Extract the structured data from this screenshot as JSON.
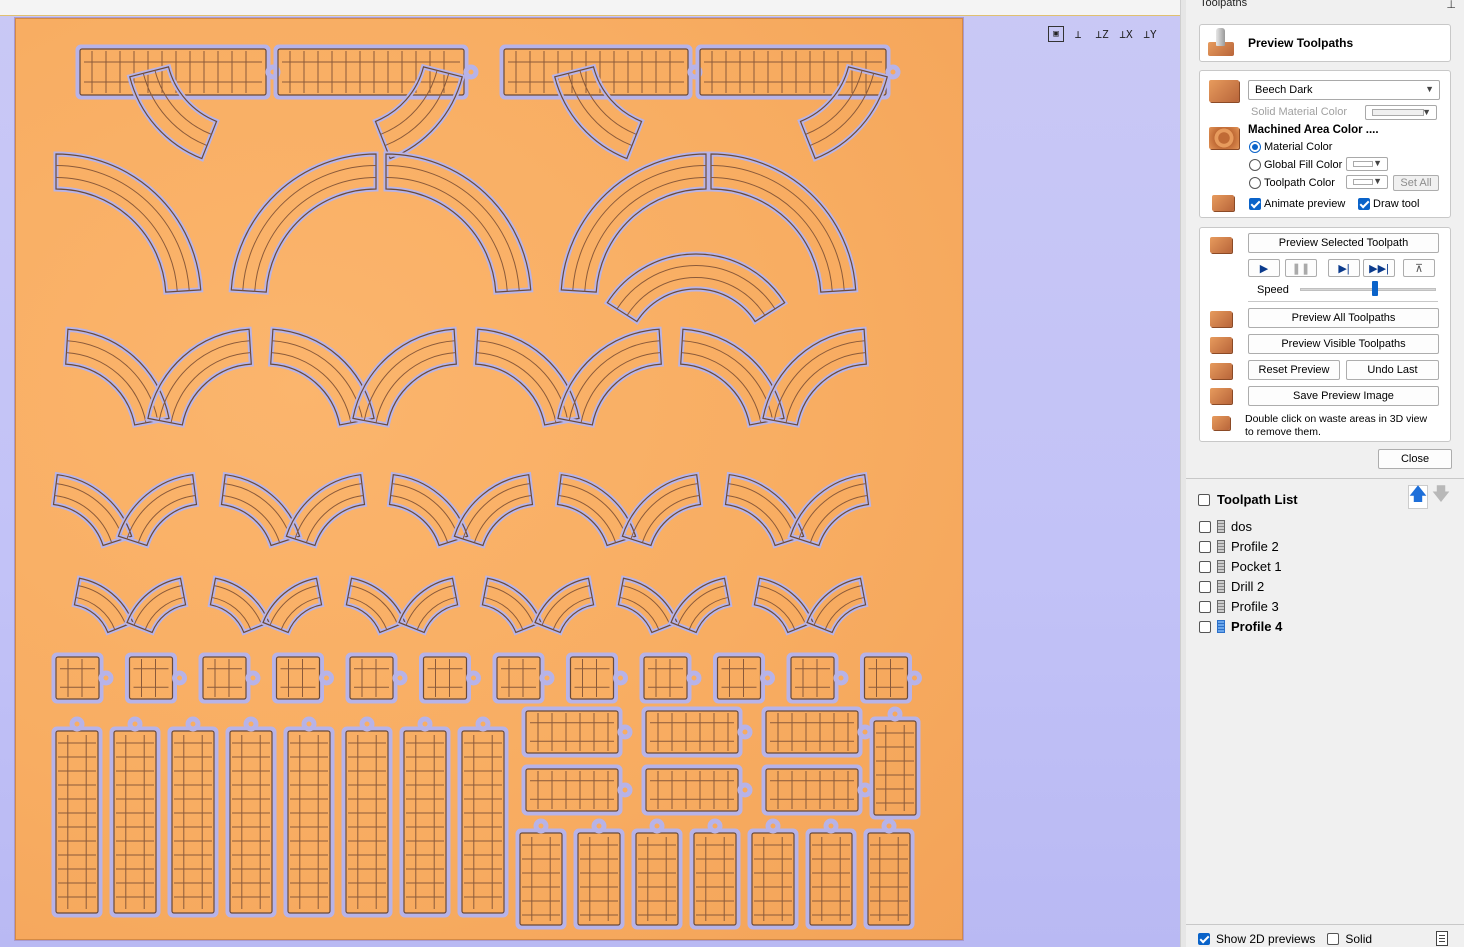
{
  "panel": {
    "title": "Toolpaths",
    "header_title": "Preview Toolpaths"
  },
  "material": {
    "selected": "Beech Dark",
    "solid_color_label": "Solid Material Color",
    "machined_label": "Machined Area Color ....",
    "options": {
      "material_color": "Material Color",
      "global_fill": "Global Fill Color",
      "toolpath_color": "Toolpath Color"
    },
    "selected_option": "material_color",
    "set_all": "Set All",
    "animate_preview": "Animate preview",
    "draw_tool": "Draw tool"
  },
  "preview": {
    "selected_btn": "Preview Selected Toolpath",
    "speed_label": "Speed",
    "speed_level": 0.55,
    "all_btn": "Preview All Toolpaths",
    "visible_btn": "Preview Visible Toolpaths",
    "reset_btn": "Reset Preview",
    "undo_btn": "Undo Last",
    "save_btn": "Save Preview Image",
    "hint_line1": "Double click on waste areas in 3D view",
    "hint_line2": "to remove them."
  },
  "close_btn": "Close",
  "toolpath_list": {
    "title": "Toolpath List",
    "items": [
      {
        "label": "dos",
        "active": false
      },
      {
        "label": "Profile 2",
        "active": false
      },
      {
        "label": "Pocket 1",
        "active": false
      },
      {
        "label": "Drill 2",
        "active": false
      },
      {
        "label": "Profile 3",
        "active": false
      },
      {
        "label": "Profile 4",
        "active": true
      }
    ]
  },
  "bottom": {
    "show_2d": "Show 2D previews",
    "solid": "Solid"
  },
  "view_icons": [
    "zoom-extents-icon",
    "iso-view-icon",
    "z-view-icon",
    "x-view-icon",
    "y-view-icon"
  ],
  "colors": {
    "accent": "#0a63c9",
    "board": "#f8ad62",
    "background": "#c2c2f7",
    "toolpath": "#b7b3e8"
  }
}
